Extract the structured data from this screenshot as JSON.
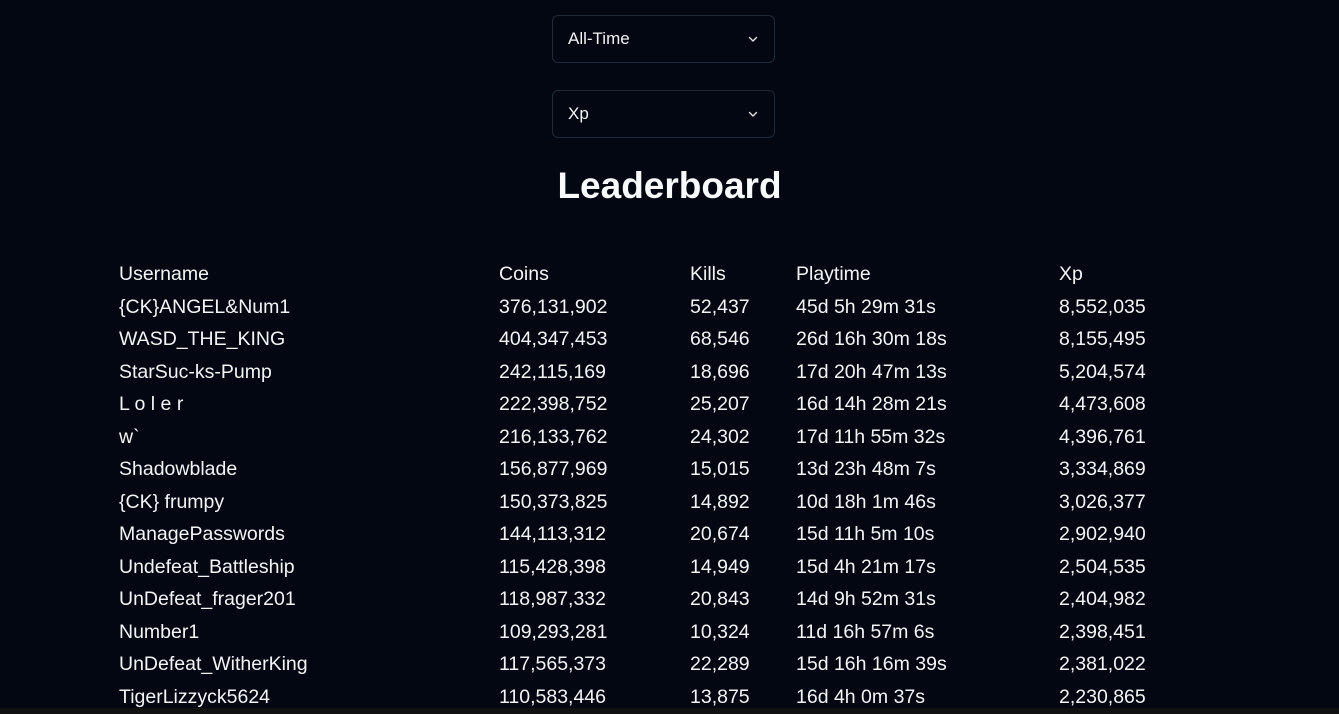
{
  "filters": {
    "time_range": "All-Time",
    "metric": "Xp"
  },
  "title": "Leaderboard",
  "table": {
    "headers": [
      "Username",
      "Coins",
      "Kills",
      "Playtime",
      "Xp"
    ],
    "rows": [
      [
        "{CK}ANGEL&Num1",
        "376,131,902",
        "52,437",
        "45d 5h 29m 31s",
        "8,552,035"
      ],
      [
        "WASD_THE_KING",
        "404,347,453",
        "68,546",
        "26d 16h 30m 18s",
        "8,155,495"
      ],
      [
        "StarSuc-ks-Pump",
        "242,115,169",
        "18,696",
        "17d 20h 47m 13s",
        "5,204,574"
      ],
      [
        "L o l e r",
        "222,398,752",
        "25,207",
        "16d 14h 28m 21s",
        "4,473,608"
      ],
      [
        "w`",
        "216,133,762",
        "24,302",
        "17d 11h 55m 32s",
        "4,396,761"
      ],
      [
        "Shadowblade",
        "156,877,969",
        "15,015",
        "13d 23h 48m 7s",
        "3,334,869"
      ],
      [
        "{CK} frumpy",
        "150,373,825",
        "14,892",
        "10d 18h 1m 46s",
        "3,026,377"
      ],
      [
        "ManagePasswords",
        "144,113,312",
        "20,674",
        "15d 11h 5m 10s",
        "2,902,940"
      ],
      [
        "Undefeat_Battleship",
        "115,428,398",
        "14,949",
        "15d 4h 21m 17s",
        "2,504,535"
      ],
      [
        "UnDefeat_frager201",
        "118,987,332",
        "20,843",
        "14d 9h 52m 31s",
        "2,404,982"
      ],
      [
        "Number1",
        "109,293,281",
        "10,324",
        "11d 16h 57m 6s",
        "2,398,451"
      ],
      [
        "UnDefeat_WitherKing",
        "117,565,373",
        "22,289",
        "15d 16h 16m 39s",
        "2,381,022"
      ],
      [
        "TigerLizzyck5624",
        "110,583,446",
        "13,875",
        "16d 4h 0m 37s",
        "2,230,865"
      ]
    ]
  },
  "colors": {
    "background": "#030712",
    "text": "#f3f4f6",
    "border": "#1f2937"
  },
  "icons": {
    "dropdown": "chevron-down-icon"
  }
}
